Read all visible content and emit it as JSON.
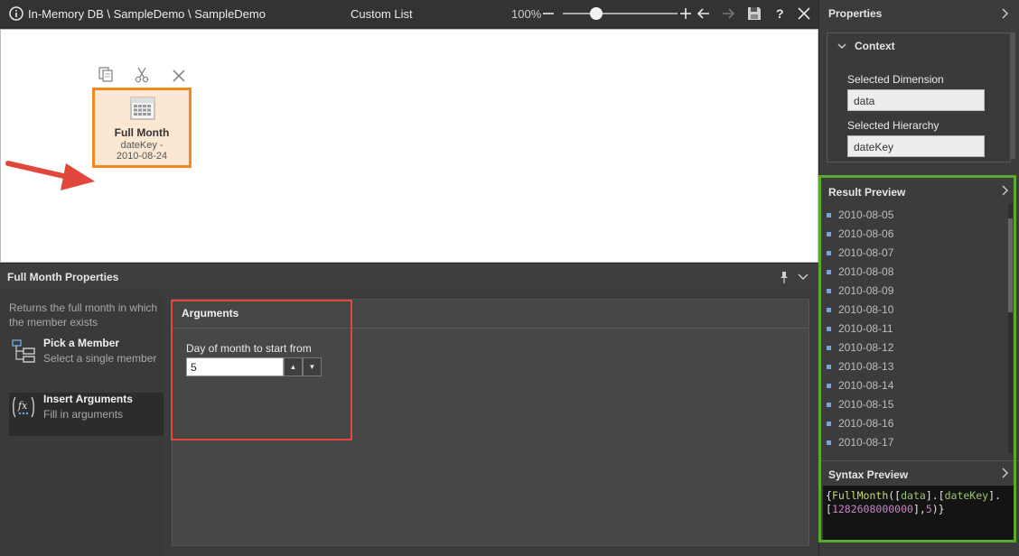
{
  "topbar": {
    "breadcrumb": "In-Memory DB \\ SampleDemo \\ SampleDemo",
    "title": "Custom List",
    "zoom": "100%"
  },
  "canvas": {
    "node": {
      "title": "Full Month",
      "subtitle_line1": "dateKey -",
      "subtitle_line2": "2010-08-24"
    }
  },
  "properties_panel": {
    "title": "Full Month Properties",
    "description": "Returns the full month in which the member exists",
    "steps": [
      {
        "title": "Pick a Member",
        "subtitle": "Select a single member"
      },
      {
        "title": "Insert Arguments",
        "subtitle": "Fill in arguments"
      }
    ],
    "arguments": {
      "title": "Arguments",
      "field_label": "Day of month to start from",
      "field_value": "5"
    }
  },
  "side": {
    "properties_title": "Properties",
    "context": {
      "title": "Context",
      "dimension_label": "Selected Dimension",
      "dimension_value": "data",
      "hierarchy_label": "Selected Hierarchy",
      "hierarchy_value": "dateKey"
    },
    "result_preview": {
      "title": "Result Preview",
      "items": [
        "2010-08-05",
        "2010-08-06",
        "2010-08-07",
        "2010-08-08",
        "2010-08-09",
        "2010-08-10",
        "2010-08-11",
        "2010-08-12",
        "2010-08-13",
        "2010-08-14",
        "2010-08-15",
        "2010-08-16",
        "2010-08-17"
      ]
    },
    "syntax_preview": {
      "title": "Syntax Preview",
      "line1_fn": "FullMonth",
      "line1_dim": "data",
      "line1_hier": "dateKey",
      "line2_num": "1282608000000",
      "line2_arg": "5"
    }
  },
  "colors": {
    "highlight_red": "#e2473c",
    "highlight_green": "#5aa82c",
    "node_border": "#f08a20",
    "node_fill": "#fce7d3"
  }
}
